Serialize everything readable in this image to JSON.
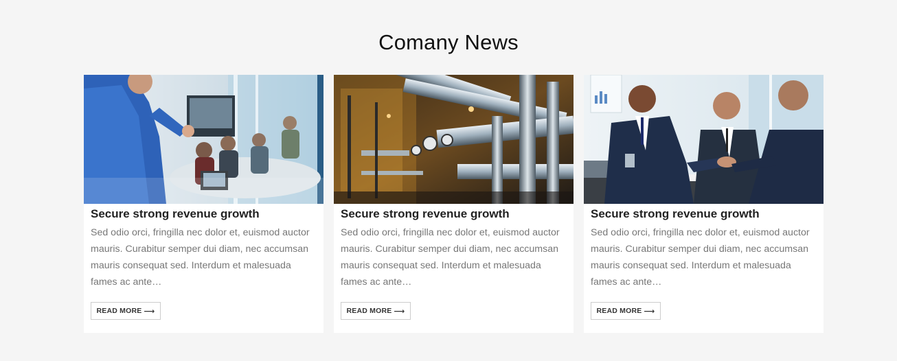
{
  "section": {
    "title": "Comany News"
  },
  "cards": [
    {
      "image": "presentation-meeting-photo",
      "title": "Secure strong revenue growth",
      "text": "Sed odio orci, fringilla nec dolor et, euismod auctor mauris. Curabitur semper dui diam, nec accumsan mauris consequat sed. Interdum et malesuada fames ac ante…",
      "button": "READ MORE",
      "arrow": "⟶"
    },
    {
      "image": "industrial-pipes-photo",
      "title": "Secure strong revenue growth",
      "text": "Sed odio orci, fringilla nec dolor et, euismod auctor mauris. Curabitur semper dui diam, nec accumsan mauris consequat sed. Interdum et malesuada fames ac ante…",
      "button": "READ MORE",
      "arrow": "⟶"
    },
    {
      "image": "business-handshake-photo",
      "title": "Secure strong revenue growth",
      "text": "Sed odio orci, fringilla nec dolor et, euismod auctor mauris. Curabitur semper dui diam, nec accumsan mauris consequat sed. Interdum et malesuada fames ac ante…",
      "button": "READ MORE",
      "arrow": "⟶"
    }
  ]
}
